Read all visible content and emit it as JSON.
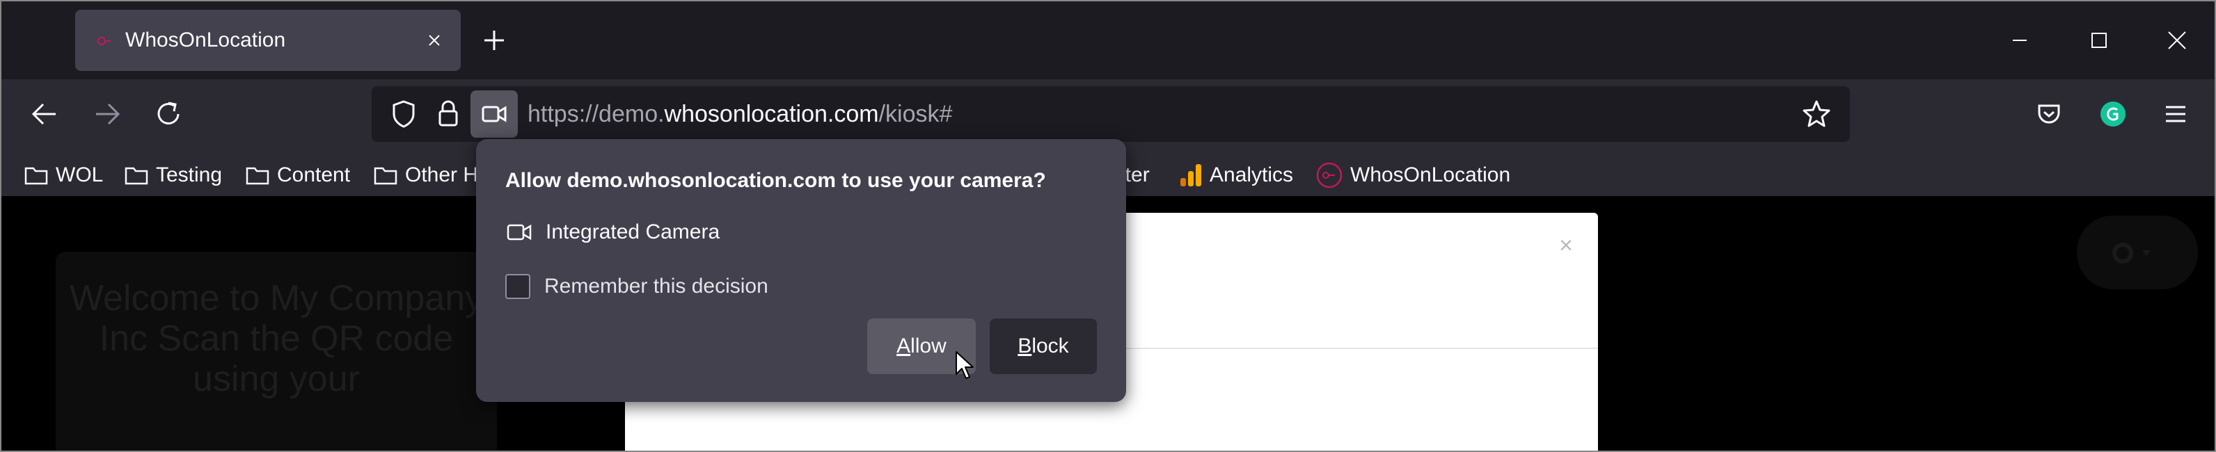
{
  "tab": {
    "title": "WhosOnLocation"
  },
  "address": {
    "scheme": "https://demo.",
    "host": "whosonlocation.com",
    "path": "/kiosk#"
  },
  "bookmarks": [
    {
      "label": "WOL",
      "icon": "folder-icon"
    },
    {
      "label": "Testing",
      "icon": "folder-icon"
    },
    {
      "label": "Content",
      "icon": "folder-icon"
    },
    {
      "label": "Other H",
      "icon": "folder-icon"
    },
    {
      "label": "nter"
    },
    {
      "label": "Analytics",
      "icon": "analytics-icon"
    },
    {
      "label": "WhosOnLocation",
      "icon": "wol-icon"
    }
  ],
  "permission_popup": {
    "title": "Allow demo.whosonlocation.com to use your camera?",
    "device": "Integrated Camera",
    "remember_label": "Remember this decision",
    "remember_checked": false,
    "allow_label": "Allow",
    "block_label": "Block"
  },
  "page": {
    "welcome_text": "Welcome to My Company Inc Scan the QR code using your",
    "modal_close": "×"
  },
  "colors": {
    "tabstrip": "#1c1b22",
    "toolbar": "#2b2a33",
    "popup": "#42414d",
    "grammarly": "#15c39a",
    "wol_brand": "#c2185b"
  }
}
